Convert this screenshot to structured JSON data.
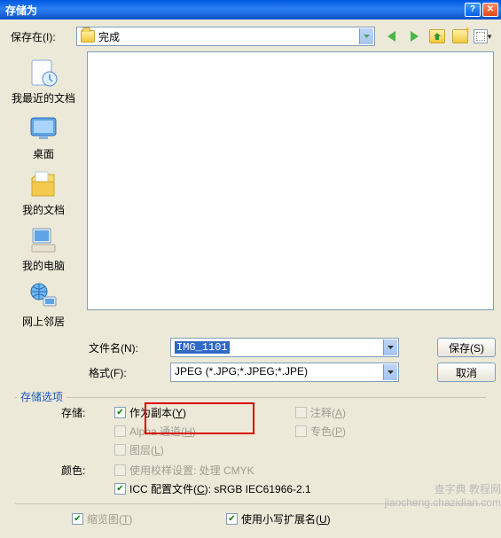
{
  "window": {
    "title": "存储为"
  },
  "location": {
    "label": "保存在(I):",
    "value": "完成"
  },
  "places": [
    {
      "name": "我最近的文档"
    },
    {
      "name": "桌面"
    },
    {
      "name": "我的文档"
    },
    {
      "name": "我的电脑"
    },
    {
      "name": "网上邻居"
    }
  ],
  "fileName": {
    "label": "文件名(N):",
    "value": "IMG_1101"
  },
  "format": {
    "label": "格式(F):",
    "value": "JPEG (*.JPG;*.JPEG;*.JPE)"
  },
  "buttons": {
    "save": "保存(S)",
    "cancel": "取消"
  },
  "options": {
    "title": "存储选项",
    "storageLabel": "存储:",
    "asCopy": "作为副本(Y)",
    "annotations": "注释(A)",
    "alpha": "Alpha 通道(H)",
    "spot": "专色(P)",
    "layers": "图层(L)",
    "colorLabel": "颜色:",
    "proof": "使用校样设置: 处理 CMYK",
    "icc": "ICC 配置文件(C): sRGB IEC61966-2.1",
    "thumbnail": "缩览图(T)",
    "lowercase": "使用小写扩展名(U)"
  },
  "watermark": {
    "line1": "查字典 教程网",
    "line2": "jiaocheng.chazidian.com"
  }
}
